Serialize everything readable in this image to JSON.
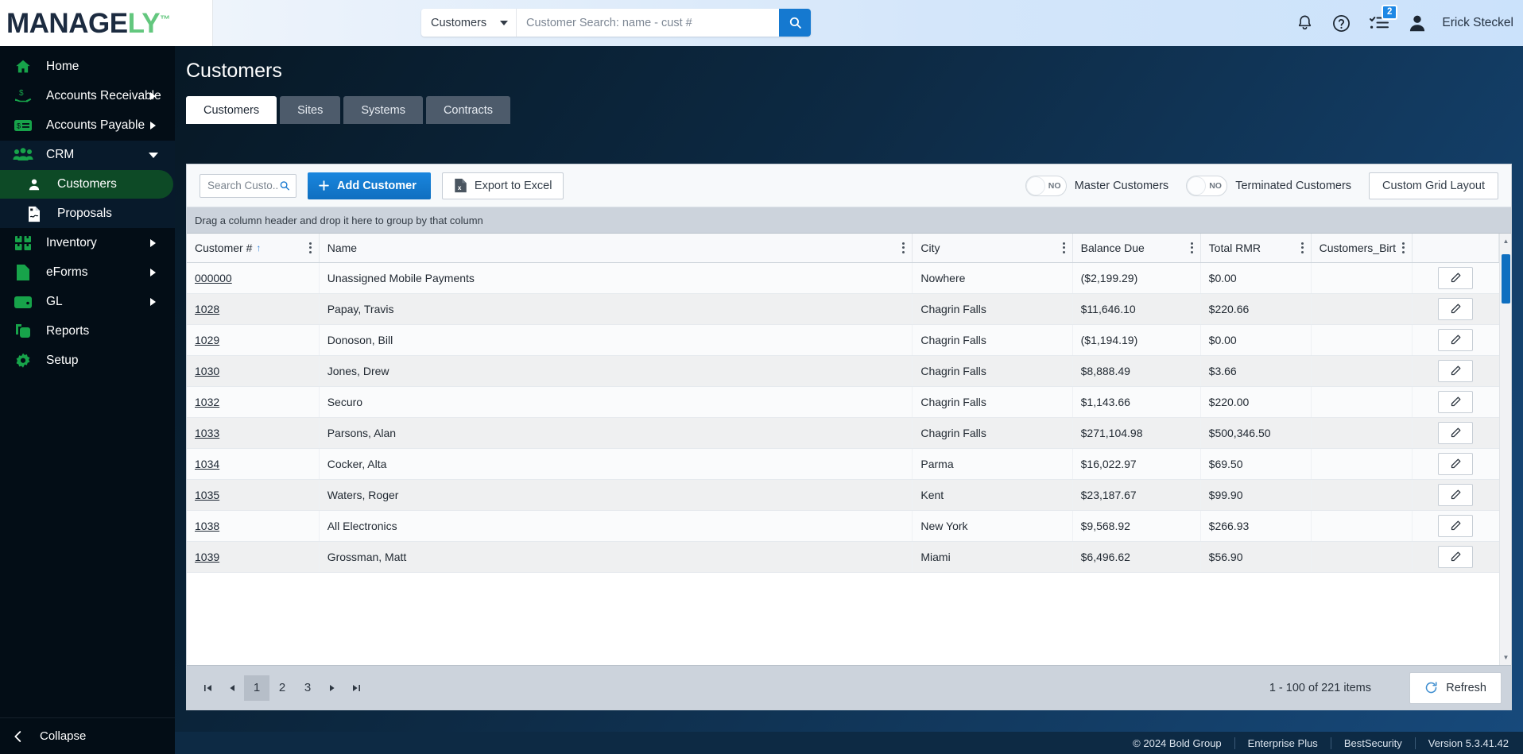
{
  "brand": {
    "logo_main": "MANAGE",
    "logo_accent": "LY",
    "logo_tm": "™",
    "accent_green": "#63c77e",
    "accent_blue": "#1579d0",
    "navy": "#0d2a44"
  },
  "topbar": {
    "search_scope": "Customers",
    "search_placeholder": "Customer Search: name - cust #",
    "search_value": "",
    "notifications_icon": "bell-icon",
    "help_icon": "question-circle-icon",
    "tasks_icon": "checklist-icon",
    "tasks_badge": "2",
    "avatar_icon": "user-avatar-icon",
    "user_name": "Erick Steckel"
  },
  "sidebar": {
    "items": [
      {
        "label": "Home",
        "icon": "home-icon",
        "has_arrow": false,
        "level": 0
      },
      {
        "label": "Accounts Receivable",
        "icon": "hand-dollar-icon",
        "has_arrow": true,
        "level": 0
      },
      {
        "label": "Accounts Payable",
        "icon": "bill-icon",
        "has_arrow": true,
        "level": 0
      },
      {
        "label": "CRM",
        "icon": "people-icon",
        "has_arrow": true,
        "expanded": true,
        "level": 0
      },
      {
        "label": "Customers",
        "icon": "person-icon",
        "has_arrow": false,
        "level": 1,
        "active": true
      },
      {
        "label": "Proposals",
        "icon": "document-signature-icon",
        "has_arrow": false,
        "level": 1
      },
      {
        "label": "Inventory",
        "icon": "boxes-icon",
        "has_arrow": true,
        "level": 0
      },
      {
        "label": "eForms",
        "icon": "file-icon",
        "has_arrow": true,
        "level": 0
      },
      {
        "label": "GL",
        "icon": "wallet-icon",
        "has_arrow": true,
        "level": 0
      },
      {
        "label": "Reports",
        "icon": "copy-icon",
        "has_arrow": false,
        "level": 0
      },
      {
        "label": "Setup",
        "icon": "gear-icon",
        "has_arrow": false,
        "level": 0
      }
    ],
    "collapse_label": "Collapse",
    "collapse_icon": "chevron-left-circle-icon"
  },
  "page": {
    "title": "Customers",
    "tabs": [
      {
        "label": "Customers",
        "active": true
      },
      {
        "label": "Sites",
        "active": false
      },
      {
        "label": "Systems",
        "active": false
      },
      {
        "label": "Contracts",
        "active": false
      }
    ]
  },
  "toolbar": {
    "grid_search_placeholder": "Search Custo...",
    "grid_search_value": "",
    "search_icon": "magnifier-icon",
    "add_label": "Add Customer",
    "add_icon": "plus-icon",
    "export_label": "Export to Excel",
    "export_icon": "excel-file-icon",
    "toggle_master": {
      "label": "Master Customers",
      "state": "NO"
    },
    "toggle_terminated": {
      "label": "Terminated Customers",
      "state": "NO"
    },
    "custom_grid_label": "Custom Grid Layout"
  },
  "grid": {
    "group_hint": "Drag a column header and drop it here to group by that column",
    "columns": [
      {
        "label": "Customer #",
        "sorted": "asc",
        "sort_glyph": "↑"
      },
      {
        "label": "Name"
      },
      {
        "label": "City"
      },
      {
        "label": "Balance Due"
      },
      {
        "label": "Total RMR"
      },
      {
        "label": "Customers_Birt"
      },
      {
        "label": ""
      }
    ],
    "row_action_icon": "pencil-icon",
    "rows": [
      {
        "id": "000000",
        "name": "Unassigned Mobile Payments",
        "city": "Nowhere",
        "balance": "($2,199.29)",
        "rmr": "$0.00",
        "birth": ""
      },
      {
        "id": "1028",
        "name": "Papay, Travis",
        "city": "Chagrin Falls",
        "balance": "$11,646.10",
        "rmr": "$220.66",
        "birth": ""
      },
      {
        "id": "1029",
        "name": "Donoson, Bill",
        "city": "Chagrin Falls",
        "balance": "($1,194.19)",
        "rmr": "$0.00",
        "birth": ""
      },
      {
        "id": "1030",
        "name": "Jones, Drew",
        "city": "Chagrin Falls",
        "balance": "$8,888.49",
        "rmr": "$3.66",
        "birth": ""
      },
      {
        "id": "1032",
        "name": "Securo",
        "city": "Chagrin Falls",
        "balance": "$1,143.66",
        "rmr": "$220.00",
        "birth": ""
      },
      {
        "id": "1033",
        "name": "Parsons, Alan",
        "city": "Chagrin Falls",
        "balance": "$271,104.98",
        "rmr": "$500,346.50",
        "birth": ""
      },
      {
        "id": "1034",
        "name": "Cocker, Alta",
        "city": "Parma",
        "balance": "$16,022.97",
        "rmr": "$69.50",
        "birth": ""
      },
      {
        "id": "1035",
        "name": "Waters, Roger",
        "city": "Kent",
        "balance": "$23,187.67",
        "rmr": "$99.90",
        "birth": ""
      },
      {
        "id": "1038",
        "name": "All Electronics",
        "city": "New York",
        "balance": "$9,568.92",
        "rmr": "$266.93",
        "birth": ""
      },
      {
        "id": "1039",
        "name": "Grossman, Matt",
        "city": "Miami",
        "balance": "$6,496.62",
        "rmr": "$56.90",
        "birth": ""
      }
    ]
  },
  "pager": {
    "first_icon": "go-to-first-icon",
    "prev_icon": "go-to-prev-icon",
    "next_icon": "go-to-next-icon",
    "last_icon": "go-to-last-icon",
    "pages": [
      "1",
      "2",
      "3"
    ],
    "current_page": "1",
    "info": "1 - 100 of 221 items",
    "refresh_label": "Refresh",
    "refresh_icon": "refresh-icon"
  },
  "footer": {
    "copyright": "© 2024 Bold Group",
    "edition": "Enterprise Plus",
    "product": "BestSecurity",
    "version": "Version 5.3.41.42"
  }
}
